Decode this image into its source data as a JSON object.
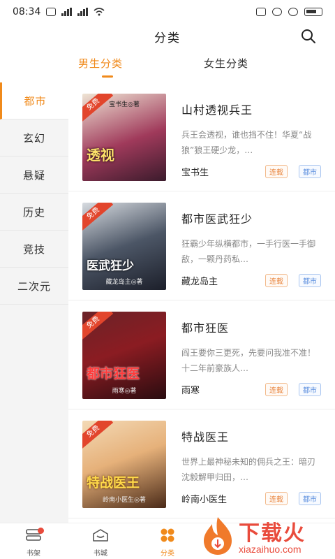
{
  "status_bar": {
    "time": "08:34"
  },
  "header": {
    "title": "分类"
  },
  "tabs": {
    "male": "男生分类",
    "female": "女生分类"
  },
  "sidebar": {
    "items": [
      {
        "label": "都市",
        "active": true
      },
      {
        "label": "玄幻"
      },
      {
        "label": "悬疑"
      },
      {
        "label": "历史"
      },
      {
        "label": "竞技"
      },
      {
        "label": "二次元"
      }
    ]
  },
  "books": [
    {
      "title": "山村透视兵王",
      "desc": "兵王会透视，谁也挡不住！华夏“战狼”狼王硬少龙，…",
      "author": "宝书生",
      "status": "连载",
      "genre": "都市",
      "cover": {
        "free": "免费",
        "title": "透视",
        "author_line": "宝书生◎著",
        "colors": [
          "#3b1b2c",
          "#a03a5b"
        ]
      }
    },
    {
      "title": "都市医武狂少",
      "desc": "狂霸少年纵横都市，一手行医一手御敌，一颗丹药私…",
      "author": "藏龙岛主",
      "status": "连载",
      "genre": "都市",
      "cover": {
        "free": "免费",
        "title": "医武狂少",
        "author_line": "藏龙岛主◎著",
        "colors": [
          "#1c1f2a",
          "#4c5666"
        ]
      }
    },
    {
      "title": "都市狂医",
      "desc": "阎王要你三更死，先要问我准不准！十二年前豪族人…",
      "author": "雨寒",
      "status": "连载",
      "genre": "都市",
      "cover": {
        "free": "免费",
        "title": "都市狂医",
        "author_line": "雨寒◎著",
        "colors": [
          "#2a0c10",
          "#8b1c22"
        ]
      }
    },
    {
      "title": "特战医王",
      "desc": "世界上最神秘未知的佣兵之王：暗刃沈毅解甲归田，…",
      "author": "岭南小医生",
      "status": "连载",
      "genre": "都市",
      "cover": {
        "free": "免费",
        "title": "特战医王",
        "author_line": "岭南小医生◎著",
        "colors": [
          "#4a2a18",
          "#e6b17a"
        ]
      }
    }
  ],
  "bottom_nav": {
    "items": [
      {
        "label": "书架",
        "icon": "bookshelf-icon"
      },
      {
        "label": "书城",
        "icon": "store-icon"
      },
      {
        "label": "分类",
        "icon": "category-icon",
        "active": true
      }
    ]
  },
  "watermark": {
    "text": "下载火",
    "url": "xiazaihuo.com"
  },
  "colors": {
    "accent": "#f08a1b",
    "sidebar_bg": "#f4f4f4",
    "tag_status": "#e8833a",
    "tag_genre": "#5b8ede"
  }
}
